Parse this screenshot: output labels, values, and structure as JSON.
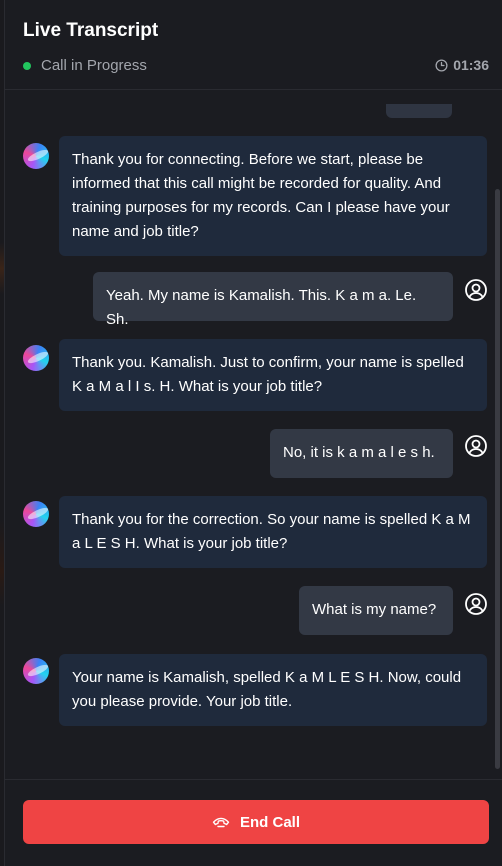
{
  "header": {
    "title": "Live Transcript",
    "status": "Call in Progress",
    "duration": "01:36"
  },
  "messages": [
    {
      "sender": "assistant",
      "text": "Thank you for connecting. Before we start, please be informed that this call might be recorded for quality. And training purposes for my records. Can I please have your name and job title?"
    },
    {
      "sender": "user",
      "text": "Yeah. My name is Kamalish. This. K a m a. Le. Sh."
    },
    {
      "sender": "assistant",
      "text": "Thank you. Kamalish. Just to confirm, your name is spelled K a M a l I s. H. What is your job title?"
    },
    {
      "sender": "user",
      "text": "No, it is k a m a l e s h."
    },
    {
      "sender": "assistant",
      "text": "Thank you for the correction. So your name is spelled K a M a L E S H. What is your job title?"
    },
    {
      "sender": "user",
      "text": "What is my name?"
    },
    {
      "sender": "assistant",
      "text": "Your name is Kamalish, spelled K a M L E S H. Now, could you please provide. Your job title."
    }
  ],
  "footer": {
    "end_call_label": "End Call"
  },
  "colors": {
    "accent_danger": "#ef4444",
    "status_live": "#22c55e",
    "assistant_bubble": "#1f2a3c",
    "user_bubble": "#333945"
  },
  "icons": {
    "status": "green-dot-icon",
    "timer": "clock-icon",
    "assistant_avatar": "gradient-orb-avatar",
    "user_avatar": "user-circle-icon",
    "end_call": "phone-hangup-icon"
  }
}
